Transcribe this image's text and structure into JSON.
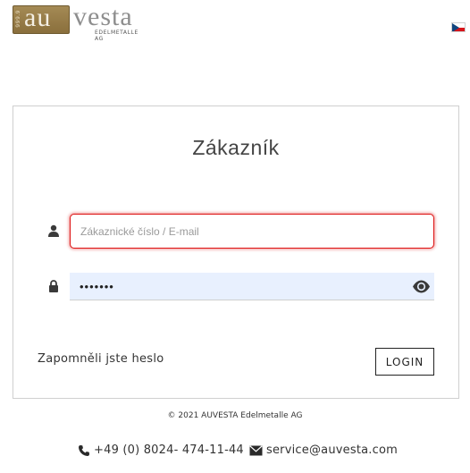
{
  "logo": {
    "purity": "999.9",
    "brand_au": "au",
    "brand_rest": "vesta",
    "tagline": "EDELMETALLE AG"
  },
  "language": {
    "current": "cs",
    "flag_colors": {
      "white": "#ffffff",
      "red": "#d7141a",
      "blue": "#11457e"
    }
  },
  "login_card": {
    "title": "Zákazník",
    "username": {
      "placeholder": "Zákaznické číslo / E-mail",
      "value": "",
      "icon": "user-icon"
    },
    "password": {
      "value": "•••••••",
      "icon": "lock-icon",
      "toggle_icon": "eye-icon"
    },
    "forgot_link": "Zapomněli jste heslo",
    "login_button": "LOGIN"
  },
  "footer": {
    "copyright": "© 2021 AUVESTA Edelmetalle AG",
    "phone": "+49 (0) 8024- 474-11-44",
    "email": "service@auvesta.com"
  },
  "colors": {
    "error_border": "#dd1111",
    "autofill_bg": "#e8f0fe",
    "brand_gold": "#9a7f48"
  }
}
